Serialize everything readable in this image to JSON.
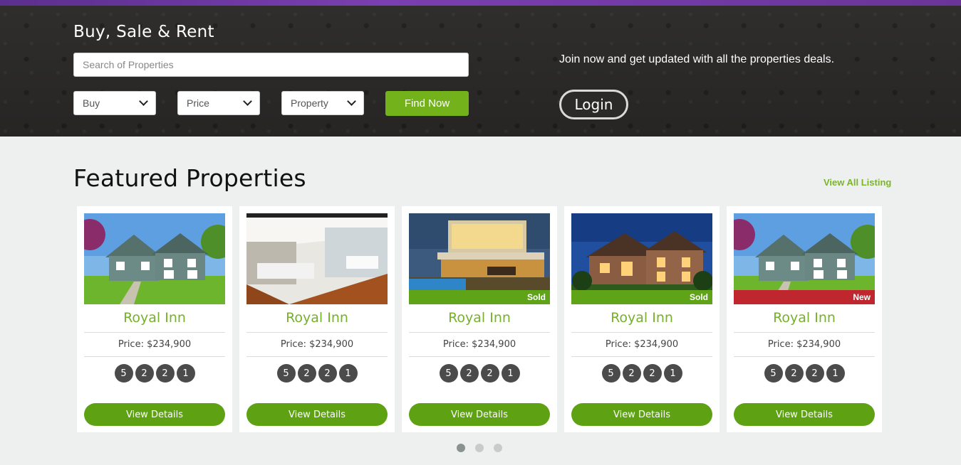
{
  "hero": {
    "title": "Buy, Sale & Rent",
    "search_placeholder": "Search of Properties",
    "selects": [
      {
        "value": "Buy"
      },
      {
        "value": "Price"
      },
      {
        "value": "Property"
      }
    ],
    "find_label": "Find Now",
    "join_text": "Join now and get updated with all the properties deals.",
    "login_label": "Login"
  },
  "featured": {
    "title": "Featured Properties",
    "view_all_label": "View All Listing",
    "cards": [
      {
        "name": "Royal Inn",
        "price": "Price: $234,900",
        "features": [
          "5",
          "2",
          "2",
          "1"
        ],
        "badge": "",
        "photo": "house-day-icon",
        "details_label": "View Details"
      },
      {
        "name": "Royal Inn",
        "price": "Price: $234,900",
        "features": [
          "5",
          "2",
          "2",
          "1"
        ],
        "badge": "",
        "photo": "interior-icon",
        "details_label": "View Details"
      },
      {
        "name": "Royal Inn",
        "price": "Price: $234,900",
        "features": [
          "5",
          "2",
          "2",
          "1"
        ],
        "badge": "Sold",
        "photo": "modern-house-pool-icon",
        "details_label": "View Details"
      },
      {
        "name": "Royal Inn",
        "price": "Price: $234,900",
        "features": [
          "5",
          "2",
          "2",
          "1"
        ],
        "badge": "Sold",
        "photo": "house-night-icon",
        "details_label": "View Details"
      },
      {
        "name": "Royal Inn",
        "price": "Price: $234,900",
        "features": [
          "5",
          "2",
          "2",
          "1"
        ],
        "badge": "New",
        "photo": "house-day-icon",
        "details_label": "View Details"
      }
    ]
  },
  "colors": {
    "accent_green": "#73b21b",
    "sold_badge": "#5fa319",
    "new_badge": "#c0262d",
    "hero_bg": "#2c2b2a"
  },
  "carousel": {
    "pages": 3,
    "active": 0
  }
}
